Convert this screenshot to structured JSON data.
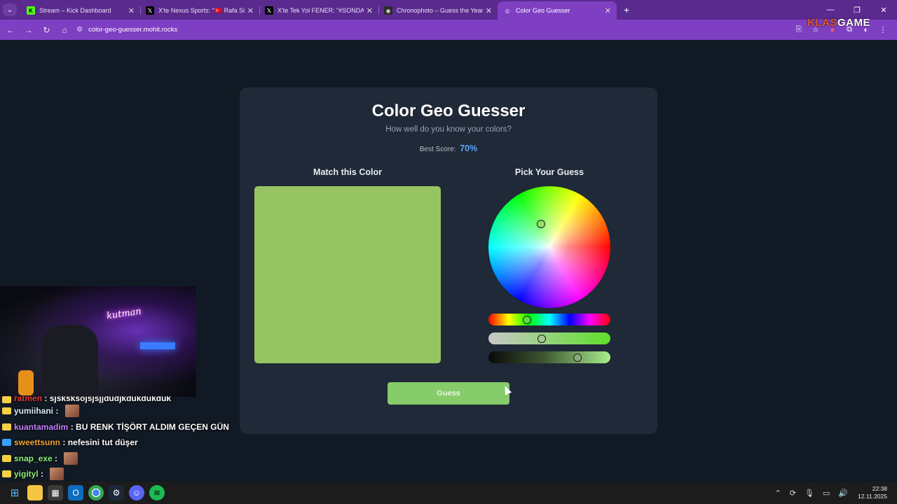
{
  "browser": {
    "tabs": [
      {
        "title": "Stream – Kick Dashboard",
        "favicon": "kick-icon",
        "active": false
      },
      {
        "title": "X'te Nexus Sports: \"🇹🇷 Rafa Silva",
        "favicon": "x-icon",
        "active": false
      },
      {
        "title": "X'te Tek Yol FENER: \"#SONDAKİKA",
        "favicon": "x-icon",
        "active": false
      },
      {
        "title": "Chronophoto – Guess the Year",
        "favicon": "camera-icon",
        "active": false
      },
      {
        "title": "Color Geo Guesser",
        "favicon": "globe-icon",
        "active": true
      }
    ],
    "url": "color-geo-guesser.mohit.rocks",
    "overlay_logo_left": "KLAS",
    "overlay_logo_right": "GAME"
  },
  "app": {
    "title": "Color Geo Guesser",
    "subtitle": "How well do you know your colors?",
    "best_score_label": "Best Score:",
    "best_score_value": "70%",
    "match_heading": "Match this Color",
    "pick_heading": "Pick Your Guess",
    "target_color": "#97c463",
    "guess_button": "Guess",
    "hue_slider_level": 0.3,
    "saturation_slider_level": 0.43,
    "lightness_slider_level": 0.75,
    "wheel_knob_angle_deg": 110,
    "wheel_knob_radius_fraction": 0.4
  },
  "chat": [
    {
      "user": "ratmen",
      "text": "sjsksksojsjsjjdudjkdukdukduk",
      "user_color": "#e53935",
      "cut": true
    },
    {
      "user": "yumiihani",
      "text": "",
      "user_color": "#d8f0ff",
      "emote": true
    },
    {
      "user": "kuantamadim",
      "text": "BU RENK TİŞÖRT ALDIM GEÇEN GÜN",
      "user_color": "#c77dff"
    },
    {
      "user": "sweettsunn",
      "text": "nefesini tut düşer",
      "user_color": "#f2a23a"
    },
    {
      "user": "snap_exe",
      "text": "",
      "user_color": "#8ef07d",
      "emote": true
    },
    {
      "user": "yigityl",
      "text": "",
      "user_color": "#8ef07d",
      "emote": true
    }
  ],
  "webcam": {
    "neon_text": "kutman"
  },
  "taskbar": {
    "time": "22:38",
    "date": "12.11.2025"
  }
}
